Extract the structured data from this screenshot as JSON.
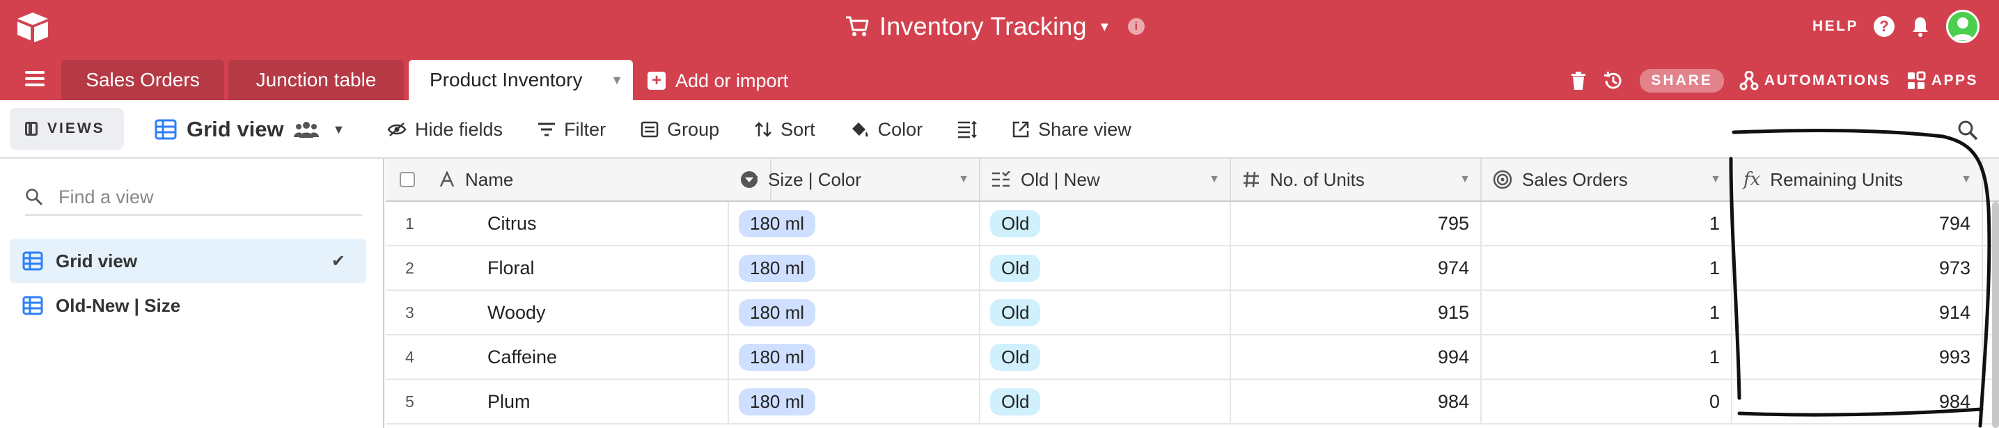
{
  "topbar": {
    "base_name": "Inventory Tracking",
    "help_label": "HELP",
    "help_icon_glyph": "?",
    "info_glyph": "i",
    "brand_color": "#d3414f"
  },
  "tabs": {
    "items": [
      {
        "label": "Sales Orders"
      },
      {
        "label": "Junction table"
      },
      {
        "label": "Product Inventory"
      }
    ],
    "add_label": "Add or import",
    "share_label": "SHARE",
    "automations_label": "AUTOMATIONS",
    "apps_label": "APPS"
  },
  "viewbar": {
    "views_label": "VIEWS",
    "current_view": "Grid view",
    "tools": {
      "hide_fields": "Hide fields",
      "filter": "Filter",
      "group": "Group",
      "sort": "Sort",
      "color": "Color",
      "share_view": "Share view"
    }
  },
  "sidebar": {
    "search_placeholder": "Find a view",
    "views": [
      {
        "label": "Grid view",
        "selected": true
      },
      {
        "label": "Old-New | Size",
        "selected": false
      }
    ]
  },
  "grid": {
    "columns": [
      {
        "label": "Name",
        "icon": "text-icon"
      },
      {
        "label": "Size | Color",
        "icon": "single-select-icon"
      },
      {
        "label": "Old | New",
        "icon": "multi-select-icon"
      },
      {
        "label": "No. of Units",
        "icon": "number-icon"
      },
      {
        "label": "Sales Orders",
        "icon": "link-icon"
      },
      {
        "label": "Remaining Units",
        "icon": "formula-icon"
      }
    ],
    "formula_glyph": "fx",
    "rows": [
      {
        "num": "1",
        "name": "Citrus",
        "size": "180 ml",
        "age": "Old",
        "units": "795",
        "orders": "1",
        "remaining": "794"
      },
      {
        "num": "2",
        "name": "Floral",
        "size": "180 ml",
        "age": "Old",
        "units": "974",
        "orders": "1",
        "remaining": "973"
      },
      {
        "num": "3",
        "name": "Woody",
        "size": "180 ml",
        "age": "Old",
        "units": "915",
        "orders": "1",
        "remaining": "914"
      },
      {
        "num": "4",
        "name": "Caffeine",
        "size": "180 ml",
        "age": "Old",
        "units": "994",
        "orders": "1",
        "remaining": "993"
      },
      {
        "num": "5",
        "name": "Plum",
        "size": "180 ml",
        "age": "Old",
        "units": "984",
        "orders": "0",
        "remaining": "984"
      }
    ]
  }
}
